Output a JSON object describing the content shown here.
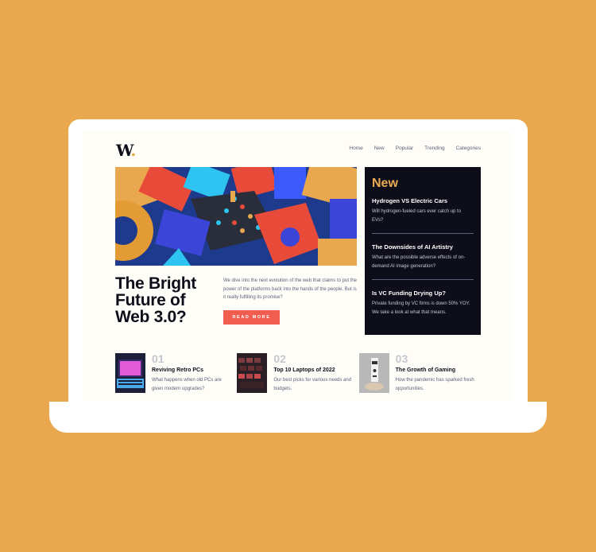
{
  "colors": {
    "background": "#E9A84E",
    "accent_red": "#F15E50",
    "dark_panel": "#0E0E1A",
    "new_orange": "#E9AB53"
  },
  "header": {
    "logo": "W",
    "logo_dot": ".",
    "nav": [
      "Home",
      "New",
      "Popular",
      "Trending",
      "Categories"
    ]
  },
  "hero": {
    "title": "The Bright Future of Web 3.0?",
    "description": "We dive into the next evolution of the web that claims to put the power of the platforms back into the hands of the people. But is it really fulfilling its promise?",
    "button": "READ MORE"
  },
  "new_panel": {
    "title": "New",
    "items": [
      {
        "title": "Hydrogen VS Electric Cars",
        "text": "Will hydrogen-fueled cars ever catch up to EVs?"
      },
      {
        "title": "The Downsides of AI Artistry",
        "text": "What are the possible adverse effects of on-demand AI image generation?"
      },
      {
        "title": "Is VC Funding Drying Up?",
        "text": "Private funding by VC firms is down 50% YOY. We take a look at what that means."
      }
    ]
  },
  "bottom": [
    {
      "num": "01",
      "title": "Reviving Retro PCs",
      "text": "What happens when old PCs are given modern upgrades?"
    },
    {
      "num": "02",
      "title": "Top 10 Laptops of 2022",
      "text": "Our best picks for various needs and budgets."
    },
    {
      "num": "03",
      "title": "The Growth of Gaming",
      "text": "How the pandemic has sparked fresh opportunities."
    }
  ]
}
